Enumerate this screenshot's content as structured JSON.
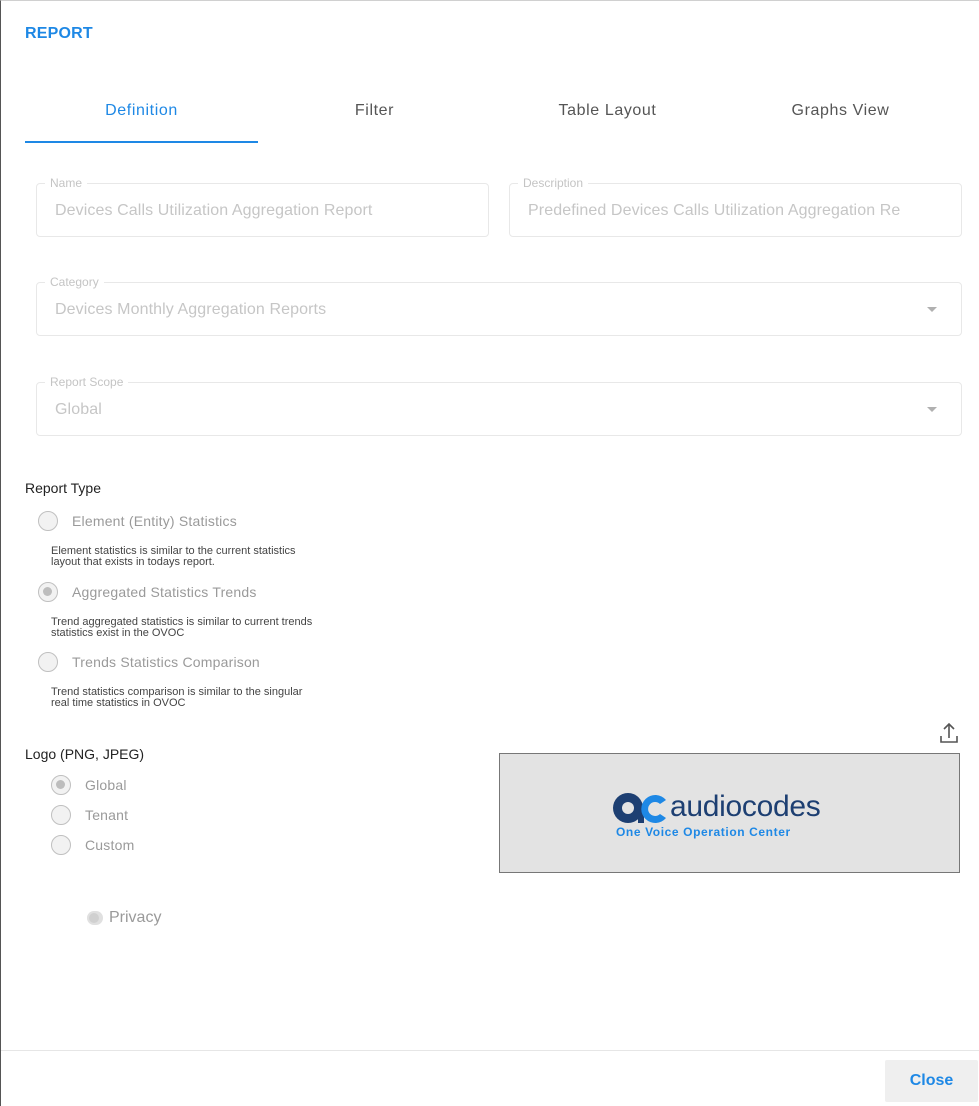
{
  "dialog": {
    "title": "REPORT"
  },
  "tabs": [
    {
      "label": "Definition",
      "active": true
    },
    {
      "label": "Filter",
      "active": false
    },
    {
      "label": "Table Layout",
      "active": false
    },
    {
      "label": "Graphs View",
      "active": false
    }
  ],
  "fields": {
    "name": {
      "label": "Name",
      "value": "Devices Calls Utilization Aggregation Report"
    },
    "description": {
      "label": "Description",
      "value": "Predefined Devices Calls Utilization Aggregation Re"
    },
    "category": {
      "label": "Category",
      "value": "Devices Monthly Aggregation Reports"
    },
    "scope": {
      "label": "Report Scope",
      "value": "Global"
    }
  },
  "report_type": {
    "title": "Report Type",
    "options": [
      {
        "label": "Element (Entity) Statistics",
        "checked": false,
        "desc_lines": [
          "Element statistics is similar to the current statistics",
          "layout that exists in todays report."
        ]
      },
      {
        "label": "Aggregated Statistics Trends",
        "checked": true,
        "desc_lines": [
          "Trend aggregated statistics is similar to current trends",
          "statistics exist in the OVOC"
        ]
      },
      {
        "label": "Trends Statistics Comparison",
        "checked": false,
        "desc_lines": [
          "Trend statistics comparison is similar to the singular",
          "real time statistics in OVOC"
        ]
      }
    ]
  },
  "logo": {
    "title": "Logo (PNG, JPEG)",
    "options": [
      {
        "label": "Global",
        "checked": true
      },
      {
        "label": "Tenant",
        "checked": false
      },
      {
        "label": "Custom",
        "checked": false
      }
    ],
    "image_word": "audiocodes",
    "image_sub": "One Voice Operation Center",
    "colors": {
      "mark": "#1d3f72",
      "accent": "#1e88e5"
    }
  },
  "privacy": {
    "label": "Privacy",
    "on": false
  },
  "footer": {
    "close_label": "Close"
  },
  "colors": {
    "accent": "#1e88e5",
    "border": "#e8e8e8"
  }
}
